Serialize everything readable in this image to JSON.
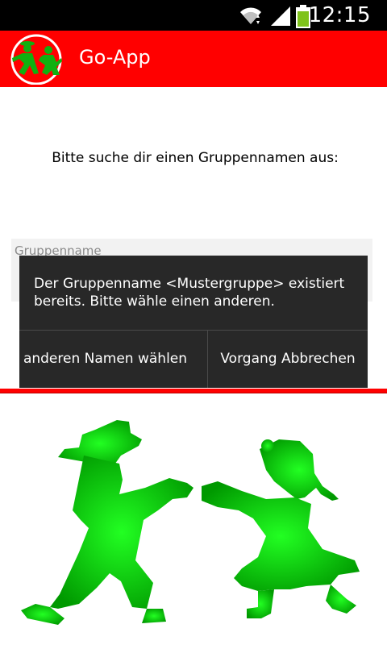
{
  "status_bar": {
    "time": "12:15",
    "icons": [
      "wifi-icon",
      "signal-icon",
      "battery-icon"
    ],
    "battery_color": "#7fc31c"
  },
  "app_bar": {
    "title": "Go-App",
    "background": "#ff0000"
  },
  "content": {
    "prompt": "Bitte suche dir einen Gruppennamen aus:",
    "group_field": {
      "placeholder": "Gruppenname",
      "value": ""
    }
  },
  "dialog": {
    "message": "Der Gruppenname <Mustergruppe> existiert bereits. Bitte wähle einen anderen.",
    "buttons": {
      "choose_other": "anderen Namen wählen",
      "cancel": "Vorgang Abbrechen"
    }
  },
  "colors": {
    "accent": "#ff0000",
    "mascot_green": "#00cc00",
    "dialog_bg": "#282828"
  }
}
